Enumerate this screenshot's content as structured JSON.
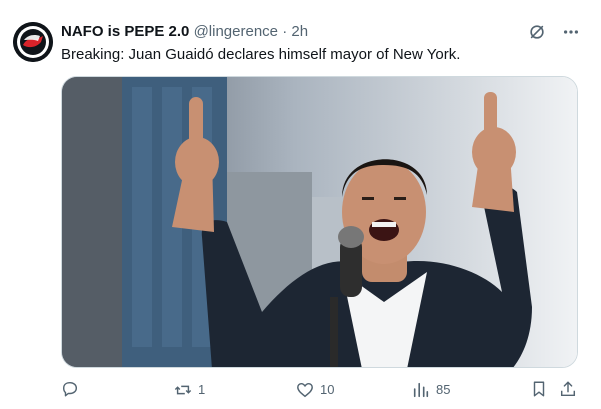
{
  "author": {
    "name": "NAFO is PEPE 2.0",
    "handle": "@lingerence",
    "dot": "·",
    "time": "2h"
  },
  "tweet": {
    "text": "Breaking: Juan Guaidó declares himself mayor of New York."
  },
  "icons": {
    "grok": "grok-icon",
    "more": "more-icon",
    "reply": "reply-icon",
    "retweet": "retweet-icon",
    "like": "like-icon",
    "views": "views-icon",
    "bookmark": "bookmark-icon",
    "share": "share-icon"
  },
  "metrics": {
    "reply_count": "",
    "retweets": "1",
    "likes": "10",
    "views": "85"
  },
  "colors": {
    "text_primary": "#0f1419",
    "text_secondary": "#536471",
    "border": "#cfd9de",
    "avatar_flag_red": "#d8232a"
  }
}
